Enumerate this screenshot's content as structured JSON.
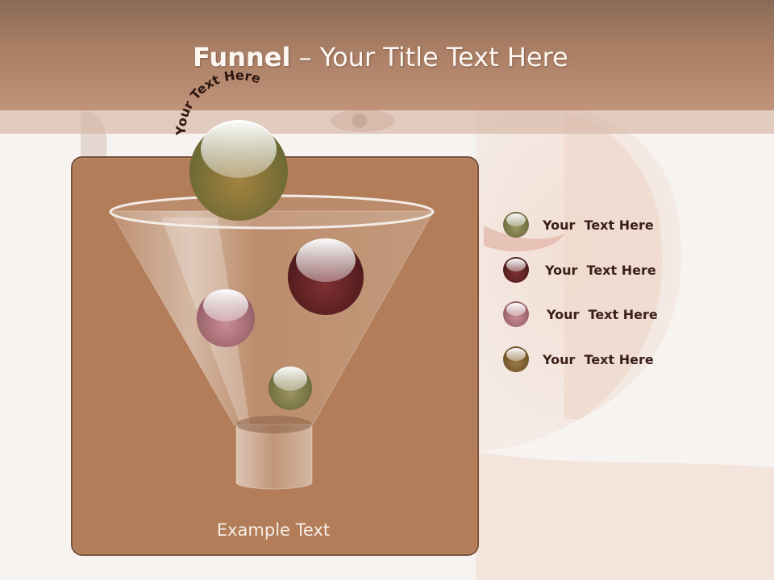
{
  "slide": {
    "title_bold": "Funnel",
    "title_rest": " – Your Title Text Here",
    "arc_text": "Your Text Here",
    "example_text": "Example Text"
  },
  "legend": [
    {
      "label": "Your  Text Here",
      "color": "#7d7a4a"
    },
    {
      "label": "Your  Text Here",
      "color": "#6a2526"
    },
    {
      "label": "Your  Text Here",
      "color": "#a56a72"
    },
    {
      "label": "Your  Text Here",
      "color": "#7b5a32"
    }
  ],
  "colors": {
    "header": "#a77d63",
    "panel": "#b27d58",
    "panel_border": "#7a5038",
    "text_dark": "#3a1f18",
    "text_light": "#fdf7f2"
  }
}
